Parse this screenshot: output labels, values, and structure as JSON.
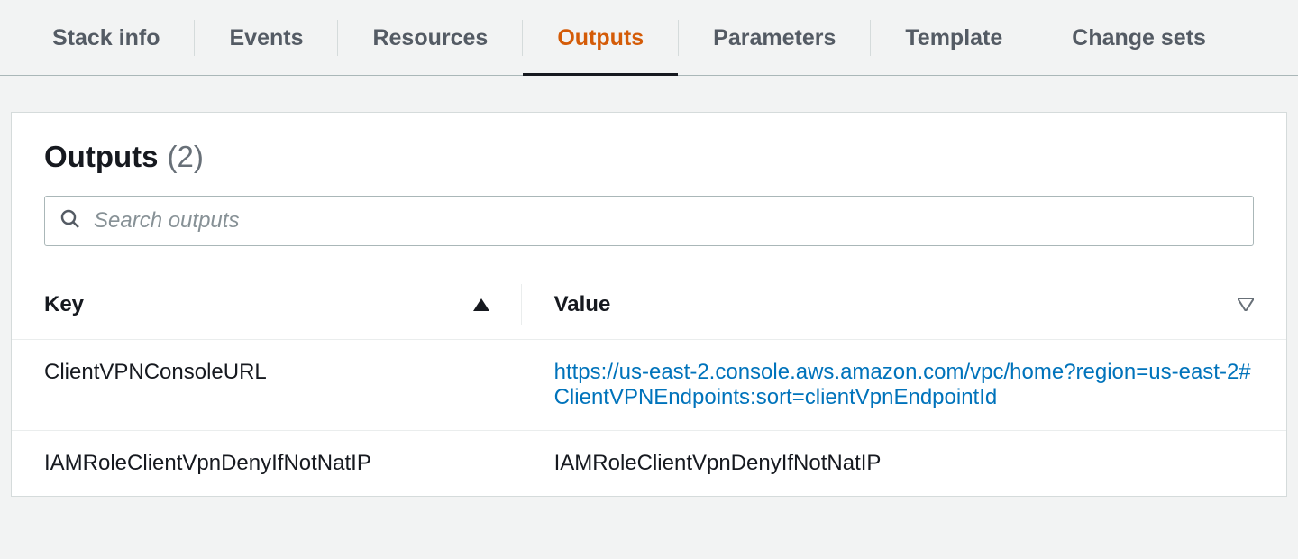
{
  "tabs": [
    {
      "id": "stack-info",
      "label": "Stack info",
      "active": false
    },
    {
      "id": "events",
      "label": "Events",
      "active": false
    },
    {
      "id": "resources",
      "label": "Resources",
      "active": false
    },
    {
      "id": "outputs",
      "label": "Outputs",
      "active": true
    },
    {
      "id": "parameters",
      "label": "Parameters",
      "active": false
    },
    {
      "id": "template",
      "label": "Template",
      "active": false
    },
    {
      "id": "change-sets",
      "label": "Change sets",
      "active": false
    }
  ],
  "panel": {
    "title": "Outputs",
    "count": "(2)"
  },
  "search": {
    "placeholder": "Search outputs",
    "value": ""
  },
  "columns": {
    "key": "Key",
    "value": "Value"
  },
  "rows": [
    {
      "key": "ClientVPNConsoleURL",
      "value": "https://us-east-2.console.aws.amazon.com/vpc/home?region=us-east-2#ClientVPNEndpoints:sort=clientVpnEndpointId",
      "is_link": true
    },
    {
      "key": "IAMRoleClientVpnDenyIfNotNatIP",
      "value": "IAMRoleClientVpnDenyIfNotNatIP",
      "is_link": false
    }
  ]
}
